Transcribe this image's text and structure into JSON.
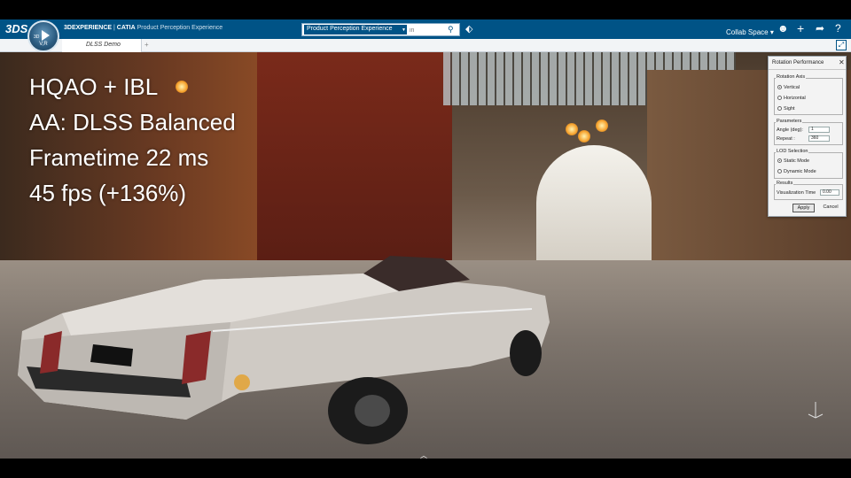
{
  "app": {
    "brand_logo": "3DS",
    "platform": "3DEXPERIENCE",
    "separator": " | ",
    "product": "CATIA",
    "app_name": "Product Perception Experience",
    "compass": {
      "label_3d": "3D",
      "label_vr": "V,R"
    }
  },
  "search": {
    "scope": "Product Perception Experience",
    "placeholder": "in",
    "icons": [
      "search-icon",
      "tag-icon"
    ]
  },
  "header_right": {
    "collab_space": "Collab Space",
    "icons": [
      "user-icon",
      "add-icon",
      "share-icon",
      "help-icon"
    ]
  },
  "tabs": [
    {
      "label": "DLSS Demo",
      "active": true
    }
  ],
  "tab_add_label": "+",
  "overlay_stats": {
    "line1": "HQAO + IBL",
    "line2": "AA: DLSS Balanced",
    "line3": "Frametime 22 ms",
    "line4": "45 fps (+136%)"
  },
  "dialog": {
    "title": "Rotation Performance",
    "rotation_axis": {
      "label": "Rotation Axis",
      "options": [
        "Vertical",
        "Horizontal",
        "Sight"
      ],
      "selected": "Vertical"
    },
    "parameters": {
      "label": "Parameters",
      "angle_label": "Angle (deg):",
      "angle_value": "1",
      "repeat_label": "Repeat :",
      "repeat_value": "360"
    },
    "lod": {
      "label": "LOD Selection",
      "options": [
        "Static Mode",
        "Dynamic Mode"
      ],
      "selected": "Static Mode"
    },
    "results": {
      "label": "Results",
      "vis_time_label": "Visualization Time",
      "vis_time_value": "0.00"
    },
    "apply": "Apply",
    "cancel": "Cancel"
  },
  "colors": {
    "topbar": "#005386",
    "overlay_text": "#ffffff"
  }
}
